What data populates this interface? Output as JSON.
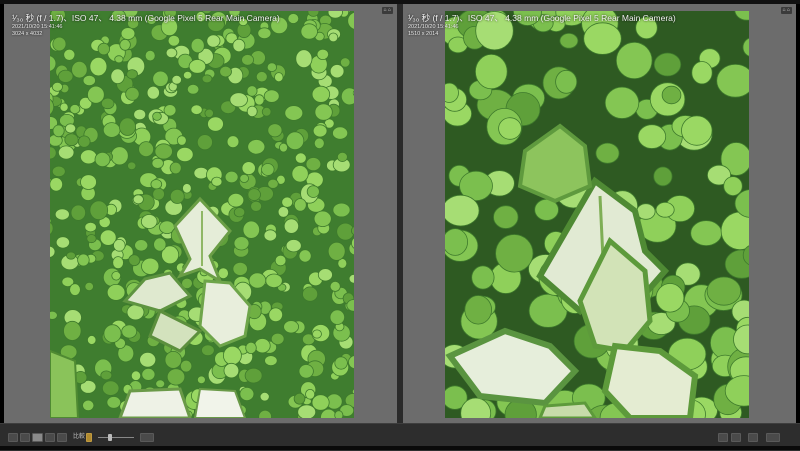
{
  "left_pane": {
    "caption": "¹⁄₃₀ 秒 (f / 1.7)、ISO 47、 4.38 mm (Google Pixel 5 Rear Main Camera)",
    "date": "2021/10/20 15:41:46",
    "dims": "3024 x 4032",
    "badge": "⌂ ⌂"
  },
  "right_pane": {
    "caption": "¹⁄₃₀ 秒 (f / 1.7)、ISO 47、 4.38 mm (Google Pixel 5 Rear Main Camera)",
    "date": "2021/10/20 15:41:46",
    "dims": "1510 x 2014",
    "badge": "⌂ ⌂"
  },
  "toolbar": {
    "compare_label": "比較",
    "zoom_label": "◂ ▸"
  },
  "colors": {
    "pane_bg": "#6c6c6c",
    "toolbar_bg": "#2d2d2d",
    "leaf_green": "#7bbf4e",
    "ivy_white": "#e9efde"
  },
  "icons": [
    "grid-view-icon",
    "loupe-view-icon",
    "compare-view-icon",
    "survey-view-icon",
    "people-view-icon",
    "lock-icon",
    "zoom-slider-icon",
    "swap-icon",
    "make-select-icon",
    "done-icon"
  ]
}
